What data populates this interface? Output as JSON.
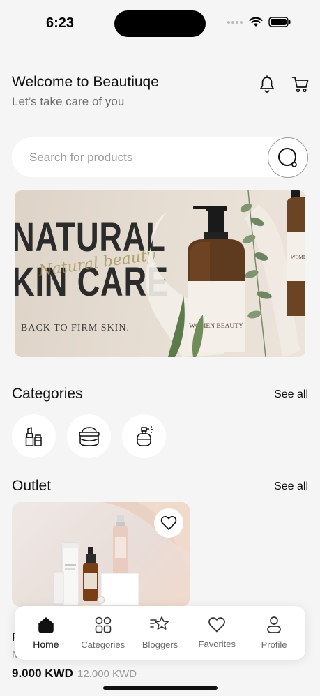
{
  "status_bar": {
    "time": "6:23"
  },
  "header": {
    "title": "Welcome to Beautiuqe",
    "subtitle": "Let’s take care of you",
    "icons": [
      "bell-icon",
      "cart-icon"
    ]
  },
  "search": {
    "placeholder": "Search for products",
    "icon": "search-icon"
  },
  "banner": {
    "title_line1": "NATURAL",
    "title_line2": "KIN CARE",
    "script": "Natural beauty",
    "subtitle": "BACK TO FIRM SKIN.",
    "bottle_label": "WOMEN BEAUTY",
    "bottle_label_2": "WOME"
  },
  "categories": {
    "title": "Categories",
    "see_all": "See all",
    "items": [
      {
        "icon": "lipstick-icon"
      },
      {
        "icon": "cream-jar-icon"
      },
      {
        "icon": "perfume-icon"
      }
    ]
  },
  "outlet": {
    "title": "Outlet",
    "see_all": "See all",
    "product": {
      "name": "F",
      "brand": "M",
      "price": "9.000 KWD",
      "old_price": "12.000 KWD"
    }
  },
  "bottom_nav": {
    "items": [
      {
        "label": "Home",
        "icon": "home-icon",
        "active": true
      },
      {
        "label": "Categories",
        "icon": "grid-icon",
        "active": false
      },
      {
        "label": "Bloggers",
        "icon": "star-icon",
        "active": false
      },
      {
        "label": "Favorites",
        "icon": "heart-icon",
        "active": false
      },
      {
        "label": "Profile",
        "icon": "profile-icon",
        "active": false
      }
    ]
  },
  "colors": {
    "background": "#f5f5f5",
    "surface": "#ffffff",
    "text": "#111111",
    "muted": "#6b6b6b"
  }
}
